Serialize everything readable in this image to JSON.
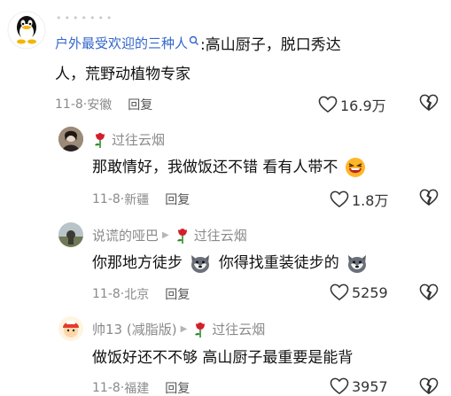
{
  "top_dots": "•••••••",
  "comments": [
    {
      "author": "户外最受欢迎的三种人",
      "text_line1": ":高山厨子，脱口秀达",
      "text_line2": "人，荒野动植物专家",
      "date": "11-8",
      "location": "安徽",
      "reply_label": "回复",
      "likes": "16.9万"
    },
    {
      "author": "过往云烟",
      "text": "那敢情好，我做饭还不错 看有人带不",
      "date": "11-8",
      "location": "新疆",
      "reply_label": "回复",
      "likes": "1.8万"
    },
    {
      "author": "说谎的哑巴",
      "reply_to": "过往云烟",
      "text_a": "你那地方徒步",
      "text_b": "你得找重装徒步的",
      "date": "11-8",
      "location": "北京",
      "reply_label": "回复",
      "likes": "5259"
    },
    {
      "author": "帅13 (减脂版)",
      "reply_to": "过往云烟",
      "text": "做饭好还不不够 高山厨子最重要是能背",
      "date": "11-8",
      "location": "福建",
      "reply_label": "回复",
      "likes": "3957"
    }
  ],
  "meta_sep": "·",
  "colors": {
    "author_blue": "#3366cc",
    "meta_gray": "#8a8a8a",
    "rose_red": "#d21f2a"
  }
}
